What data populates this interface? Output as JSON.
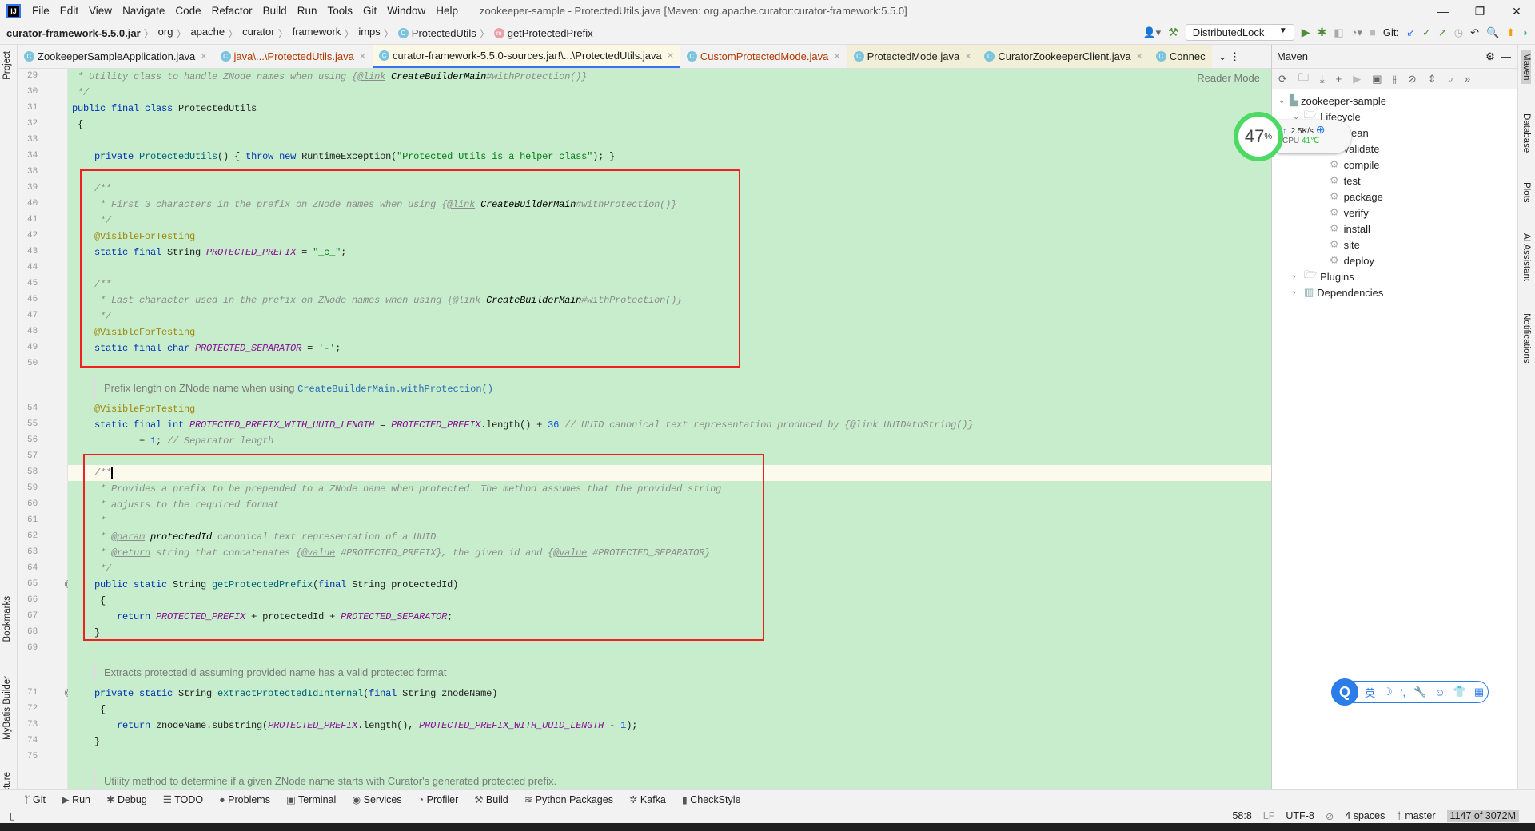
{
  "menubar": {
    "logo": "IJ",
    "items": [
      "File",
      "Edit",
      "View",
      "Navigate",
      "Code",
      "Refactor",
      "Build",
      "Run",
      "Tools",
      "Git",
      "Window",
      "Help"
    ],
    "title": "zookeeper-sample - ProtectedUtils.java [Maven: org.apache.curator:curator-framework:5.5.0]"
  },
  "breadcrumb": {
    "jar": "curator-framework-5.5.0.jar",
    "parts": [
      "org",
      "apache",
      "curator",
      "framework",
      "imps"
    ],
    "class": "ProtectedUtils",
    "method": "getProtectedPrefix"
  },
  "toolbar": {
    "run_config": "DistributedLock",
    "git_label": "Git:"
  },
  "tabs": [
    {
      "label": "ZookeeperSampleApplication.java"
    },
    {
      "label": "java\\...\\ProtectedUtils.java"
    },
    {
      "label": "curator-framework-5.5.0-sources.jar!\\...\\ProtectedUtils.java"
    },
    {
      "label": "CustomProtectedMode.java"
    },
    {
      "label": "ProtectedMode.java"
    },
    {
      "label": "CuratorZookeeperClient.java"
    },
    {
      "label": "Connec"
    }
  ],
  "editor": {
    "reader_mode": "Reader Mode",
    "lines": [
      {
        "n": "29",
        "t": [
          [
            "cm",
            " * Utility class to handle ZNode names when using {"
          ],
          [
            "tag",
            "@link"
          ],
          [
            "ref",
            " CreateBuilderMain"
          ],
          [
            "cm",
            "#withProtection()}"
          ]
        ]
      },
      {
        "n": "30",
        "t": [
          [
            "cm",
            " */"
          ]
        ]
      },
      {
        "n": "31",
        "t": [
          [
            "kw",
            "public final class "
          ],
          [
            "",
            "ProtectedUtils"
          ]
        ]
      },
      {
        "n": "32",
        "t": [
          [
            "",
            " {"
          ]
        ]
      },
      {
        "n": "33",
        "t": []
      },
      {
        "n": "34",
        "t": [
          [
            "kw",
            "    private "
          ],
          [
            "fn",
            "ProtectedUtils"
          ],
          [
            "",
            "() { "
          ],
          [
            "kw",
            "throw new "
          ],
          [
            "",
            "RuntimeException("
          ],
          [
            "str",
            "\"Protected Utils is a helper class\""
          ],
          [
            "",
            "); }"
          ]
        ]
      },
      {
        "n": "38",
        "t": []
      },
      {
        "n": "39",
        "t": [
          [
            "cm",
            "    /**"
          ]
        ]
      },
      {
        "n": "40",
        "t": [
          [
            "cm",
            "     * First 3 characters in the prefix on ZNode names when using {"
          ],
          [
            "tag",
            "@link"
          ],
          [
            "ref",
            " CreateBuilderMain"
          ],
          [
            "cm",
            "#withProtection()}"
          ]
        ]
      },
      {
        "n": "41",
        "t": [
          [
            "cm",
            "     */"
          ]
        ]
      },
      {
        "n": "42",
        "t": [
          [
            "ann",
            "    @VisibleForTesting"
          ]
        ]
      },
      {
        "n": "43",
        "t": [
          [
            "kw",
            "    static final "
          ],
          [
            "",
            "String "
          ],
          [
            "cst",
            "PROTECTED_PREFIX"
          ],
          [
            "",
            " = "
          ],
          [
            "str",
            "\"_c_\""
          ],
          [
            "",
            ";"
          ]
        ]
      },
      {
        "n": "44",
        "t": []
      },
      {
        "n": "45",
        "t": [
          [
            "cm",
            "    /**"
          ]
        ]
      },
      {
        "n": "46",
        "t": [
          [
            "cm",
            "     * Last character used in the prefix on ZNode names when using {"
          ],
          [
            "tag",
            "@link"
          ],
          [
            "ref",
            " CreateBuilderMain"
          ],
          [
            "cm",
            "#withProtection()}"
          ]
        ]
      },
      {
        "n": "47",
        "t": [
          [
            "cm",
            "     */"
          ]
        ]
      },
      {
        "n": "48",
        "t": [
          [
            "ann",
            "    @VisibleForTesting"
          ]
        ]
      },
      {
        "n": "49",
        "t": [
          [
            "kw",
            "    static final char "
          ],
          [
            "cst",
            "PROTECTED_SEPARATOR"
          ],
          [
            "",
            " = "
          ],
          [
            "str",
            "'-'"
          ],
          [
            "",
            ";"
          ]
        ]
      },
      {
        "n": "50",
        "t": []
      },
      {
        "doc": "Prefix length on ZNode name when using ",
        "link": "CreateBuilderMain.withProtection()"
      },
      {
        "n": "54",
        "t": [
          [
            "ann",
            "    @VisibleForTesting"
          ]
        ]
      },
      {
        "n": "55",
        "t": [
          [
            "kw",
            "    static final int "
          ],
          [
            "cst",
            "PROTECTED_PREFIX_WITH_UUID_LENGTH"
          ],
          [
            "",
            " = "
          ],
          [
            "cst",
            "PROTECTED_PREFIX"
          ],
          [
            "",
            ".length() + "
          ],
          [
            "num",
            "36"
          ],
          [
            "cm",
            " // UUID canonical text representation produced by {@link UUID#toString()}"
          ]
        ]
      },
      {
        "n": "56",
        "t": [
          [
            "",
            "            + "
          ],
          [
            "num",
            "1"
          ],
          [
            "",
            "; "
          ],
          [
            "cm",
            "// Separator length"
          ]
        ]
      },
      {
        "n": "57",
        "t": []
      },
      {
        "n": "58",
        "cur": true,
        "t": [
          [
            "cm",
            "    /**"
          ]
        ]
      },
      {
        "n": "59",
        "t": [
          [
            "cm",
            "     * Provides a prefix to be prepended to a ZNode name when protected. The method assumes that the provided string"
          ]
        ]
      },
      {
        "n": "60",
        "t": [
          [
            "cm",
            "     * adjusts to the required format"
          ]
        ]
      },
      {
        "n": "61",
        "t": [
          [
            "cm",
            "     *"
          ]
        ]
      },
      {
        "n": "62",
        "t": [
          [
            "cm",
            "     * "
          ],
          [
            "tag",
            "@param"
          ],
          [
            "ref",
            " protectedId"
          ],
          [
            "cm",
            " canonical text representation of a UUID"
          ]
        ]
      },
      {
        "n": "63",
        "t": [
          [
            "cm",
            "     * "
          ],
          [
            "tag",
            "@return"
          ],
          [
            "cm",
            " string that concatenates {"
          ],
          [
            "tag",
            "@value"
          ],
          [
            "cm",
            " #PROTECTED_PREFIX}, the given id and {"
          ],
          [
            "tag",
            "@value"
          ],
          [
            "cm",
            " #PROTECTED_SEPARATOR}"
          ]
        ]
      },
      {
        "n": "64",
        "t": [
          [
            "cm",
            "     */"
          ]
        ]
      },
      {
        "n": "65",
        "t": [
          [
            "kw",
            "    public static "
          ],
          [
            "",
            "String "
          ],
          [
            "fn",
            "getProtectedPrefix"
          ],
          [
            "",
            "("
          ],
          [
            "kw",
            "final "
          ],
          [
            "",
            "String protectedId)"
          ]
        ]
      },
      {
        "n": "66",
        "t": [
          [
            "",
            "     {"
          ]
        ]
      },
      {
        "n": "67",
        "t": [
          [
            "kw",
            "        return "
          ],
          [
            "cst",
            "PROTECTED_PREFIX"
          ],
          [
            "",
            " + protectedId + "
          ],
          [
            "cst",
            "PROTECTED_SEPARATOR"
          ],
          [
            "",
            ";"
          ]
        ]
      },
      {
        "n": "68",
        "t": [
          [
            "",
            "    }"
          ]
        ]
      },
      {
        "n": "69",
        "t": []
      },
      {
        "doc": "Extracts protectedId assuming provided name has a valid protected format"
      },
      {
        "n": "71",
        "t": [
          [
            "kw",
            "    private static "
          ],
          [
            "",
            "String "
          ],
          [
            "fn",
            "extractProtectedIdInternal"
          ],
          [
            "",
            "("
          ],
          [
            "kw",
            "final "
          ],
          [
            "",
            "String znodeName)"
          ]
        ]
      },
      {
        "n": "72",
        "t": [
          [
            "",
            "     {"
          ]
        ]
      },
      {
        "n": "73",
        "t": [
          [
            "kw",
            "        return "
          ],
          [
            "",
            "znodeName.substring("
          ],
          [
            "cst",
            "PROTECTED_PREFIX"
          ],
          [
            "",
            ".length(), "
          ],
          [
            "cst",
            "PROTECTED_PREFIX_WITH_UUID_LENGTH"
          ],
          [
            "",
            " - "
          ],
          [
            "num",
            "1"
          ],
          [
            "",
            ");"
          ]
        ]
      },
      {
        "n": "74",
        "t": [
          [
            "",
            "    }"
          ]
        ]
      },
      {
        "n": "75",
        "t": []
      },
      {
        "doc": "Utility method to determine if a given ZNode name starts with Curator's generated protected prefix."
      }
    ]
  },
  "maven": {
    "title": "Maven",
    "root": "zookeeper-sample",
    "lifecycle": "Lifecycle",
    "phases": [
      "clean",
      "validate",
      "compile",
      "test",
      "package",
      "verify",
      "install",
      "site",
      "deploy"
    ],
    "plugins": "Plugins",
    "dependencies": "Dependencies"
  },
  "left_strip": [
    "Project",
    "Bookmarks",
    "MyBatis Builder",
    "Structure"
  ],
  "right_strip": [
    "Maven",
    "Database",
    "Plots",
    "AI Assistant",
    "Notifications"
  ],
  "bottom_tools": [
    "Git",
    "Run",
    "Debug",
    "TODO",
    "Problems",
    "Terminal",
    "Services",
    "Profiler",
    "Build",
    "Python Packages",
    "Kafka",
    "CheckStyle"
  ],
  "status": {
    "position": "58:8",
    "line_sep": "LF",
    "encoding": "UTF-8",
    "indent": "4 spaces",
    "branch": "master",
    "memory": "1147 of 3072M"
  },
  "widget": {
    "percent": "47",
    "unit": "%",
    "net": "2.5K/s",
    "cpu_label": "CPU",
    "cpu_temp": "41℃"
  },
  "ime": {
    "logo": "Q",
    "items": [
      "英",
      "☽",
      "‘,",
      "🔧",
      "☺",
      "👕",
      "▦"
    ]
  }
}
